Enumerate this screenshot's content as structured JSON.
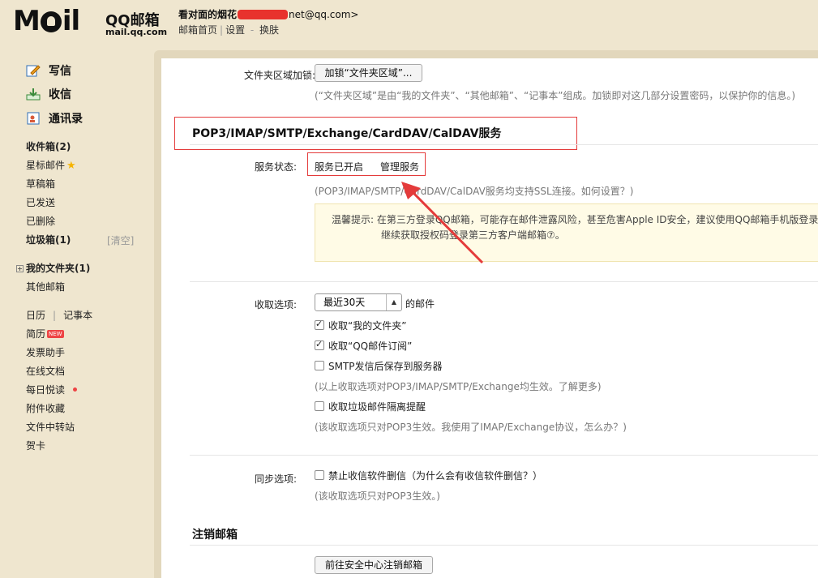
{
  "header": {
    "logo_text": "MOil",
    "logo_brand": "QQ邮箱",
    "logo_domain": "mail.qq.com",
    "user_name_prefix": "看对面的烟花",
    "user_email_suffix": "net@qq.com>",
    "links": {
      "home": "邮箱首页",
      "settings": "设置",
      "switch": "换肤",
      "sep": "|"
    }
  },
  "sidebar": {
    "compose": "写信",
    "receive": "收信",
    "contacts": "通讯录",
    "inbox": "收件箱(2)",
    "starred": "星标邮件",
    "drafts": "草稿箱",
    "sent": "已发送",
    "deleted": "已删除",
    "junk": "垃圾箱(1)",
    "clear": "[清空]",
    "my_folders": "我的文件夹(1)",
    "other_mail": "其他邮箱",
    "calendar": "日历",
    "notes": "记事本",
    "resume": "简历",
    "new_badge": "NEW",
    "invoice": "发票助手",
    "docs": "在线文档",
    "daily": "每日悦读",
    "attachments": "附件收藏",
    "transfer": "文件中转站",
    "cards": "贺卡"
  },
  "main": {
    "folder_lock": {
      "label": "文件夹区域加锁:",
      "button": "加锁“文件夹区域”...",
      "hint": "(“文件夹区域”是由“我的文件夹”、“其他邮箱”、“记事本”组成。加锁即对这几部分设置密码，以保护你的信息。)"
    },
    "pop_section_title": "POP3/IMAP/SMTP/Exchange/CardDAV/CalDAV服务",
    "service_status": {
      "label": "服务状态:",
      "value": "服务已开启",
      "manage": "管理服务",
      "ssl_hint": "(POP3/IMAP/SMTP/CardDAV/CalDAV服务均支持SSL连接。如何设置？)"
    },
    "warning": {
      "line1": "温馨提示: 在第三方登录QQ邮箱，可能存在邮件泄露风险，甚至危害Apple ID安全，建议使用QQ邮箱手机版登录。",
      "line2": "继续获取授权码登录第三方客户端邮箱⑦。"
    },
    "receive_options": {
      "label": "收取选项:",
      "select_value": "最近30天",
      "select_suffix": "的邮件",
      "opt1": "收取“我的文件夹”",
      "opt2": "收取“QQ邮件订阅”",
      "opt3": "SMTP发信后保存到服务器",
      "hint1": "(以上收取选项对POP3/IMAP/SMTP/Exchange均生效。了解更多)",
      "opt4": "收取垃圾邮件隔离提醒",
      "hint2": "(该收取选项只对POP3生效。我使用了IMAP/Exchange协议，怎么办？)"
    },
    "sync_options": {
      "label": "同步选项:",
      "opt": "禁止收信软件删信（为什么会有收信软件删信？）",
      "hint": "(该收取选项只对POP3生效。)"
    },
    "cancel_section_title": "注销邮箱",
    "cancel_button": "前往安全中心注销邮箱"
  },
  "colors": {
    "annotation": "#e43b3b",
    "background": "#efe6cf"
  }
}
